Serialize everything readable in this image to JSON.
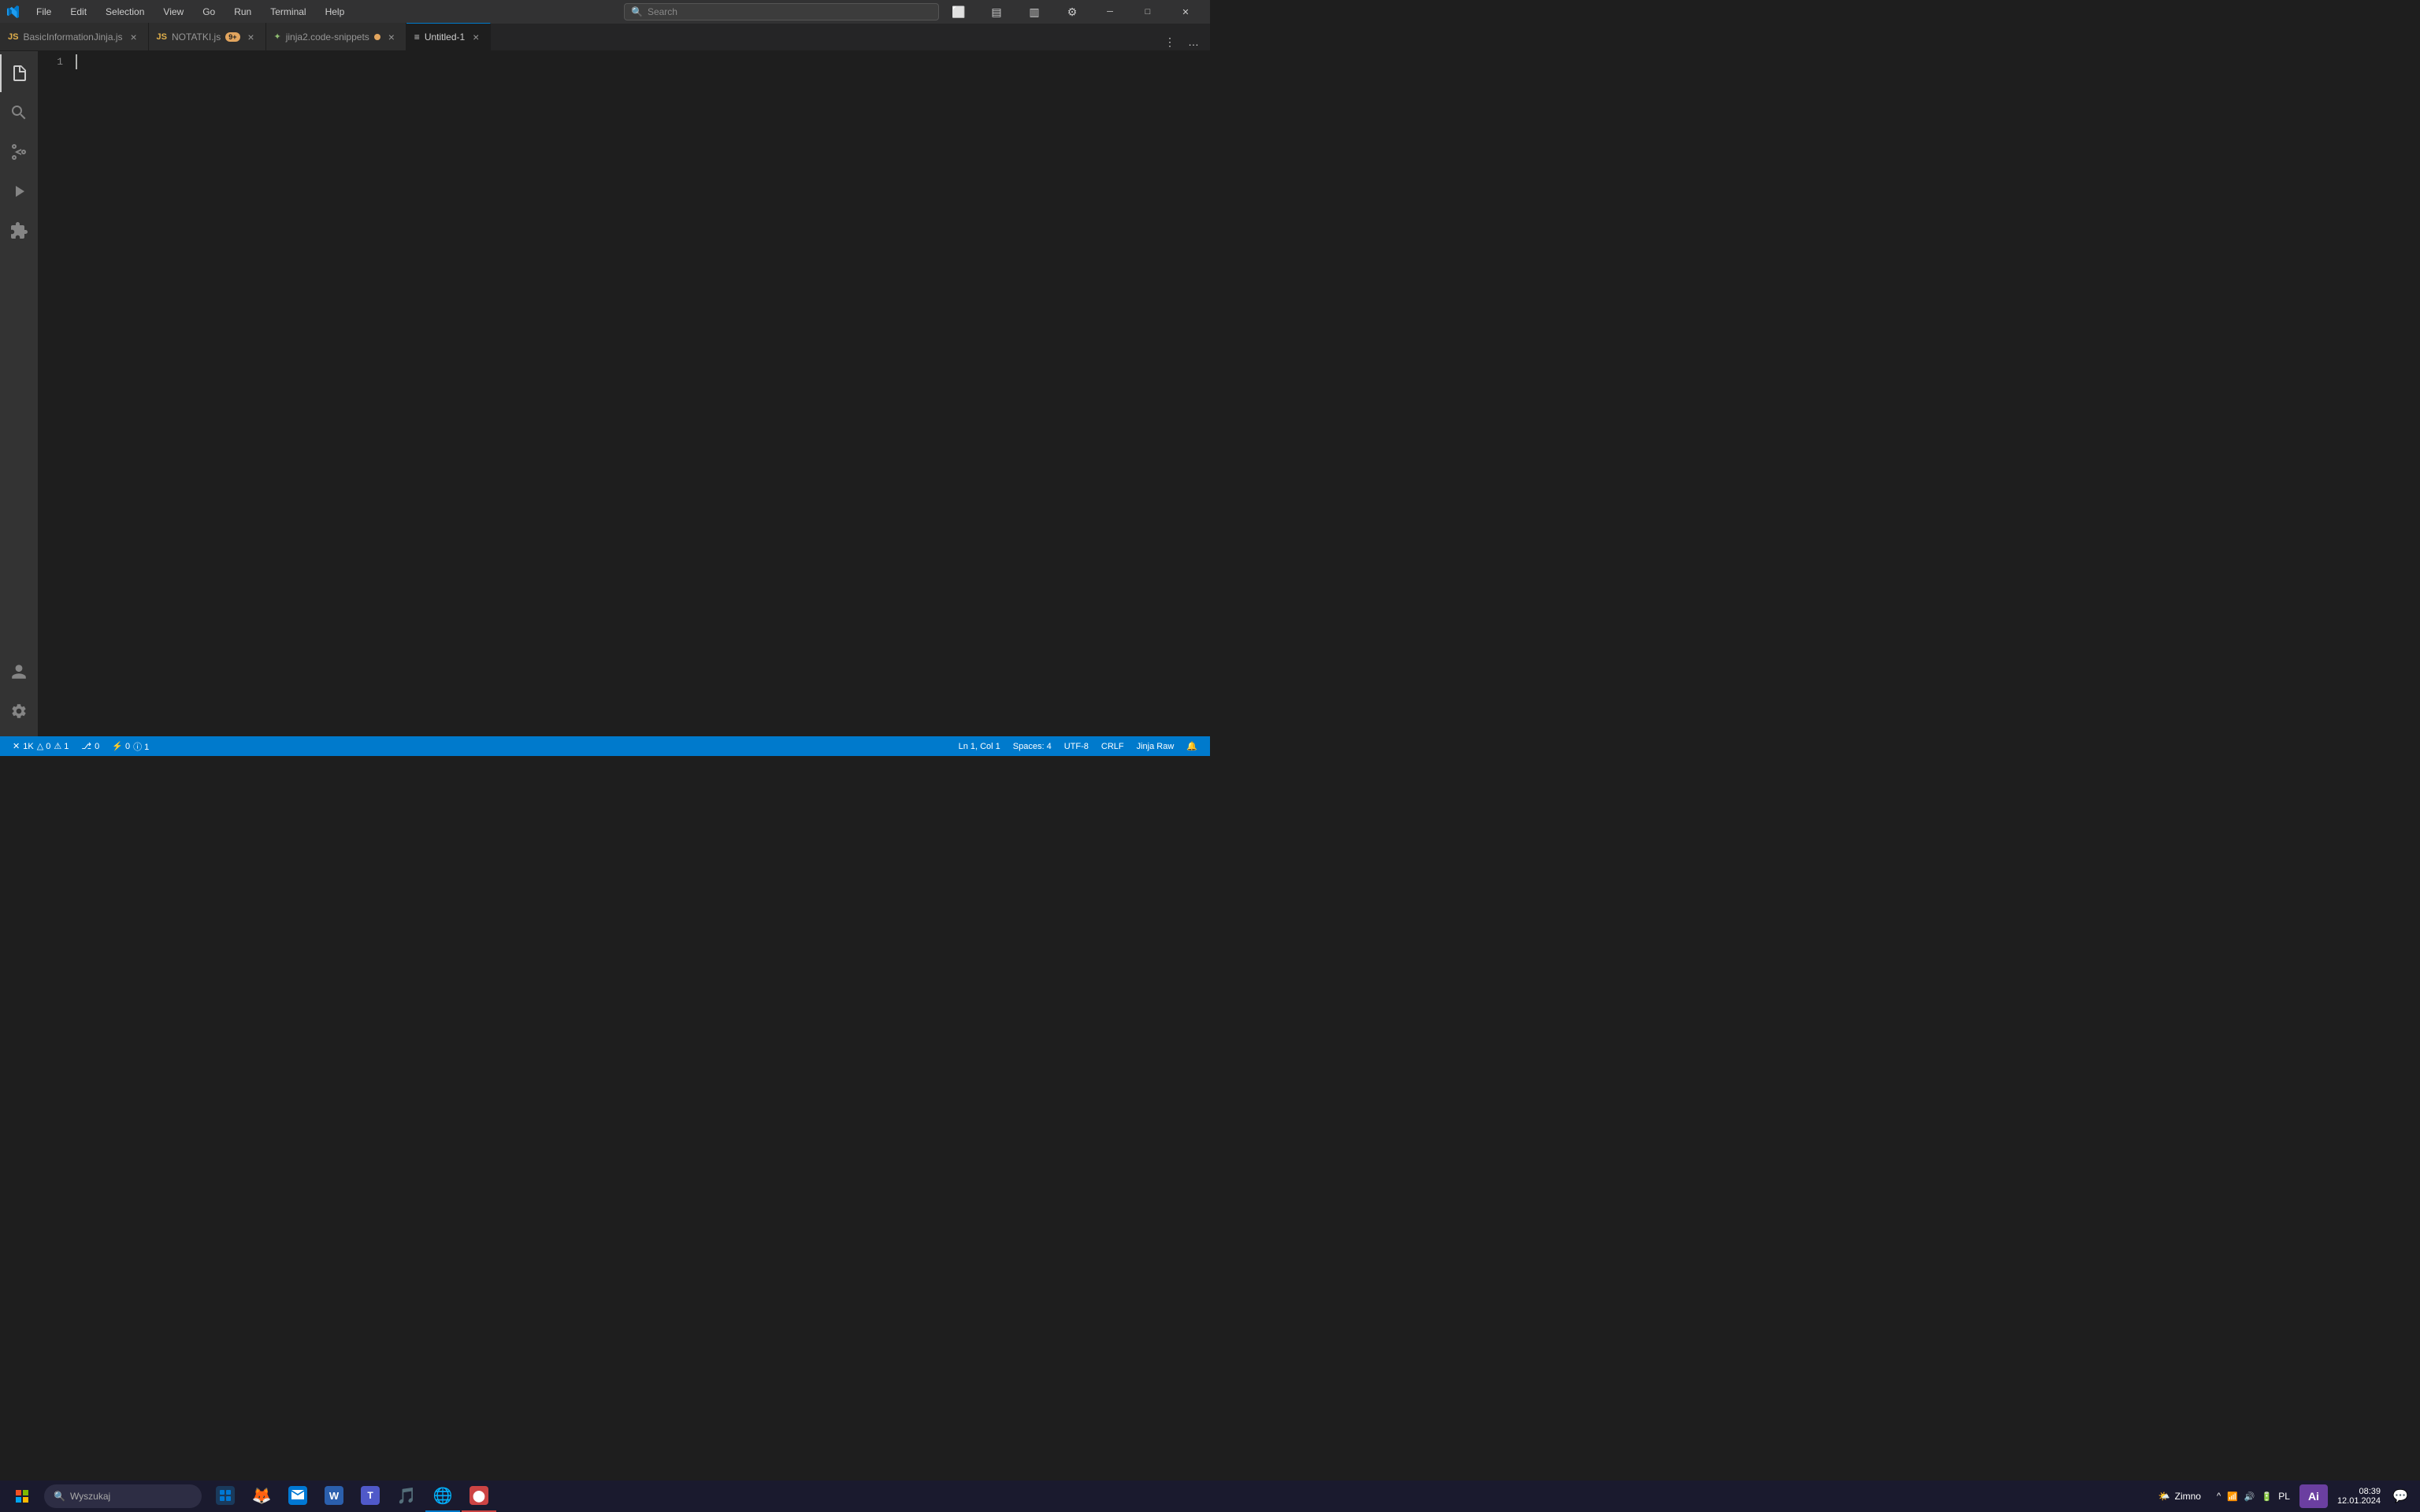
{
  "titlebar": {
    "menus": [
      "File",
      "Edit",
      "Selection",
      "View",
      "Go",
      "Run",
      "Terminal",
      "Help"
    ],
    "search_placeholder": "Search",
    "window_buttons": {
      "minimize": "─",
      "maximize": "□",
      "restore": "❐",
      "close": "✕"
    },
    "layout_icons": [
      "sidebar_icon",
      "activity_icon",
      "panel_icon",
      "customize_icon"
    ]
  },
  "tabs": [
    {
      "id": "tab-basicinfo",
      "label": "BasicInformationJinja.js",
      "icon": "js",
      "dot": false,
      "modified": false,
      "active": false
    },
    {
      "id": "tab-notatki",
      "label": "NOTATKI.js",
      "icon": "js",
      "dot": true,
      "badge": "9+",
      "modified": true,
      "active": false
    },
    {
      "id": "tab-jinja2",
      "label": "jinja2.code-snippets",
      "icon": "jinja",
      "dot": false,
      "modified": true,
      "active": false
    },
    {
      "id": "tab-untitled",
      "label": "Untitled-1",
      "icon": "plain",
      "dot": false,
      "modified": false,
      "active": true
    }
  ],
  "activity_bar": {
    "items": [
      {
        "id": "explorer",
        "icon": "📄",
        "label": "Explorer",
        "active": true
      },
      {
        "id": "search",
        "icon": "🔍",
        "label": "Search",
        "active": false
      },
      {
        "id": "source-control",
        "icon": "⎇",
        "label": "Source Control",
        "active": false
      },
      {
        "id": "run-debug",
        "icon": "▶",
        "label": "Run and Debug",
        "active": false
      },
      {
        "id": "extensions",
        "icon": "⊞",
        "label": "Extensions",
        "active": false
      }
    ],
    "bottom": [
      {
        "id": "accounts",
        "icon": "👤",
        "label": "Accounts"
      },
      {
        "id": "settings",
        "icon": "⚙",
        "label": "Settings"
      }
    ]
  },
  "editor": {
    "line_number": "1"
  },
  "status_bar": {
    "left": [
      {
        "id": "remote",
        "text": "✕  1K  △ 0  ⚠ 1"
      },
      {
        "id": "source-control",
        "text": "⎇  0"
      },
      {
        "id": "errors",
        "text": "⚡ 0  ⓘ 1"
      }
    ],
    "right": [
      {
        "id": "position",
        "text": "Ln 1, Col 1"
      },
      {
        "id": "spaces",
        "text": "Spaces: 4"
      },
      {
        "id": "encoding",
        "text": "UTF-8"
      },
      {
        "id": "eol",
        "text": "CRLF"
      },
      {
        "id": "language",
        "text": "Jinja Raw"
      },
      {
        "id": "notifications",
        "text": "🔔"
      }
    ]
  },
  "taskbar": {
    "start_icon": "⊞",
    "search_placeholder": "Wyszukaj",
    "apps": [
      {
        "id": "task-view",
        "color": "#0078d4",
        "label": "Task View"
      },
      {
        "id": "edge-old",
        "color": "#ff6600",
        "label": "Firefox"
      },
      {
        "id": "firefox",
        "color": "#e66000",
        "label": "Firefox"
      },
      {
        "id": "outlook",
        "color": "#0078d4",
        "label": "Outlook"
      },
      {
        "id": "word",
        "color": "#2b5fad",
        "label": "Word"
      },
      {
        "id": "teams",
        "color": "#5059c9",
        "label": "Teams"
      },
      {
        "id": "spotify",
        "color": "#1db954",
        "label": "Spotify"
      },
      {
        "id": "edge",
        "color": "#0078d4",
        "label": "Edge",
        "active": true
      },
      {
        "id": "vscode-taskbar",
        "color": "#cc4444",
        "label": "VSCode Active"
      }
    ],
    "system_tray": {
      "weather": {
        "icon": "🌤",
        "temp": "Zimno",
        "label": "Zimno"
      },
      "icons": [
        "⌃",
        "📶",
        "🔊",
        "🖥"
      ],
      "show_hidden": "^"
    },
    "clock": {
      "time": "08:39",
      "date": "12.01.2024"
    },
    "notification_icon": "💬",
    "ai_label": "Ai"
  }
}
